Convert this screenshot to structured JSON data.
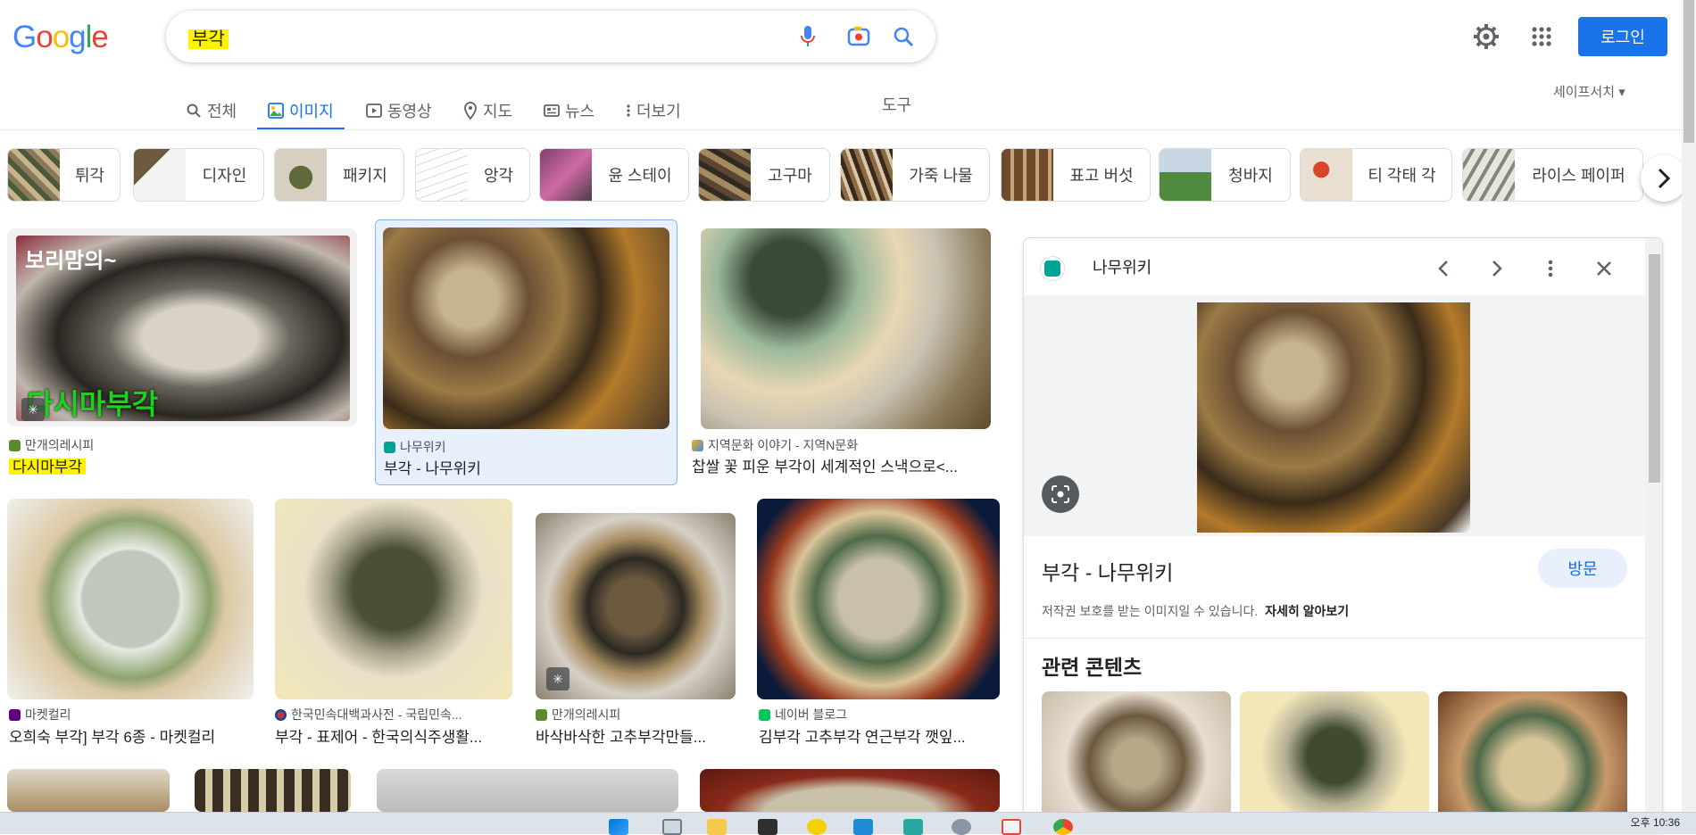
{
  "header": {
    "logo": "Google",
    "search_query": "부각",
    "login_label": "로그인",
    "colors": {
      "accent": "#1a73e8",
      "highlight": "#fef200"
    }
  },
  "tabs": [
    {
      "label": "전체",
      "icon": "search-icon"
    },
    {
      "label": "이미지",
      "icon": "image-icon",
      "active": true
    },
    {
      "label": "동영상",
      "icon": "play-icon"
    },
    {
      "label": "지도",
      "icon": "map-pin-icon"
    },
    {
      "label": "뉴스",
      "icon": "news-icon"
    },
    {
      "label": "더보기",
      "icon": "more-vert-icon"
    }
  ],
  "tools_label": "도구",
  "safesearch_label": "세이프서치",
  "chips": [
    {
      "label": "튀각"
    },
    {
      "label": "디자인"
    },
    {
      "label": "패키지"
    },
    {
      "label": "앙각"
    },
    {
      "label": "윤 스테이"
    },
    {
      "label": "고구마"
    },
    {
      "label": "가죽 나물"
    },
    {
      "label": "표고 버섯"
    },
    {
      "label": "청바지"
    },
    {
      "label": "티 각태 각"
    },
    {
      "label": "라이스 페이퍼"
    }
  ],
  "results": [
    {
      "source": "만개의레시피",
      "title": "다시마부각",
      "overlay_top": "보리맘의~",
      "overlay_bottom": "다시마부각"
    },
    {
      "source": "나무위키",
      "title": "부각 - 나무위키"
    },
    {
      "source": "지역문화 이야기 - 지역N문화",
      "title": "찹쌀 꽃 피운 부각이 세계적인 스낵으로<..."
    },
    {
      "source": "마켓컬리",
      "title": "오희숙 부각] 부각 6종 - 마켓컬리"
    },
    {
      "source": "한국민속대백과사전 - 국립민속...",
      "title": "부각 - 표제어 - 한국의식주생활..."
    },
    {
      "source": "만개의레시피",
      "title": "바삭바삭한 고추부각만들..."
    },
    {
      "source": "네이버 블로그",
      "title": "김부각 고추부각 연근부각 깻잎..."
    }
  ],
  "panel": {
    "source": "나무위키",
    "title": "부각 - 나무위키",
    "visit_label": "방문",
    "copyright_text": "저작권 보호를 받는 이미지일 수 있습니다.",
    "learn_more": "자세히 알아보기",
    "related_title": "관련 콘텐츠"
  },
  "taskbar": {
    "clock": "오후 10:36"
  }
}
